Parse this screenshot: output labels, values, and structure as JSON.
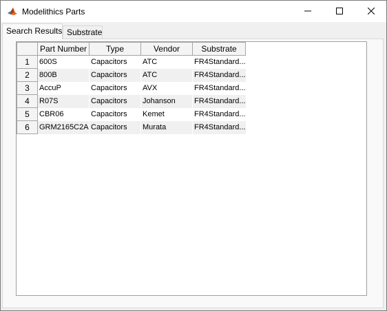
{
  "window": {
    "title": "Modelithics Parts",
    "icon": "matlab-icon",
    "controls": [
      "minimize-icon",
      "maximize-icon",
      "close-icon"
    ]
  },
  "tabs": [
    {
      "label": "Search Results",
      "active": true
    },
    {
      "label": "Substrate",
      "active": false
    }
  ],
  "table": {
    "columns": [
      "Part Number",
      "Type",
      "Vendor",
      "Substrate"
    ],
    "rows": [
      {
        "num": "1",
        "part": "600S",
        "type": "Capacitors",
        "vendor": "ATC",
        "substrate": "FR4Standard..."
      },
      {
        "num": "2",
        "part": "800B",
        "type": "Capacitors",
        "vendor": "ATC",
        "substrate": "FR4Standard..."
      },
      {
        "num": "3",
        "part": "AccuP",
        "type": "Capacitors",
        "vendor": "AVX",
        "substrate": "FR4Standard..."
      },
      {
        "num": "4",
        "part": "R07S",
        "type": "Capacitors",
        "vendor": "Johanson",
        "substrate": "FR4Standard..."
      },
      {
        "num": "5",
        "part": "CBR06",
        "type": "Capacitors",
        "vendor": "Kemet",
        "substrate": "FR4Standard..."
      },
      {
        "num": "6",
        "part": "GRM2165C2A",
        "type": "Capacitors",
        "vendor": "Murata",
        "substrate": "FR4Standard..."
      }
    ]
  }
}
